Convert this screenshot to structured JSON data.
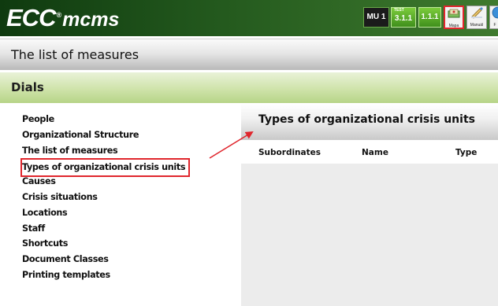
{
  "header": {
    "logo_ecc": "ECC",
    "logo_reg": "®",
    "logo_mcms": "mcms",
    "mu_label": "MU 1",
    "test_small": "TEST",
    "test_version": "3.1.1",
    "version": "1.1.1",
    "tools": [
      {
        "label": "Mapa",
        "icon": "map-icon"
      },
      {
        "label": "Manuál",
        "icon": "pencil-icon"
      },
      {
        "label": "F",
        "icon": "globe-icon"
      }
    ]
  },
  "bars": {
    "measures_title": "The list of measures",
    "dials_title": "Dials"
  },
  "menu": {
    "items": [
      {
        "label": "People"
      },
      {
        "label": "Organizational Structure"
      },
      {
        "label": "The list of measures"
      },
      {
        "label": "Types of organizational crisis units",
        "highlighted": true
      },
      {
        "label": "Causes"
      },
      {
        "label": "Crisis situations"
      },
      {
        "label": "Locations"
      },
      {
        "label": "Staff"
      },
      {
        "label": "Shortcuts"
      },
      {
        "label": "Document Classes"
      },
      {
        "label": "Printing templates"
      }
    ]
  },
  "panel": {
    "title": "Types of organizational crisis units",
    "columns": [
      "Subordinates",
      "Name",
      "Type"
    ]
  },
  "colors": {
    "highlight": "#e0262d",
    "header_green": "#245a1e",
    "dials_green": "#cfe3aa"
  }
}
